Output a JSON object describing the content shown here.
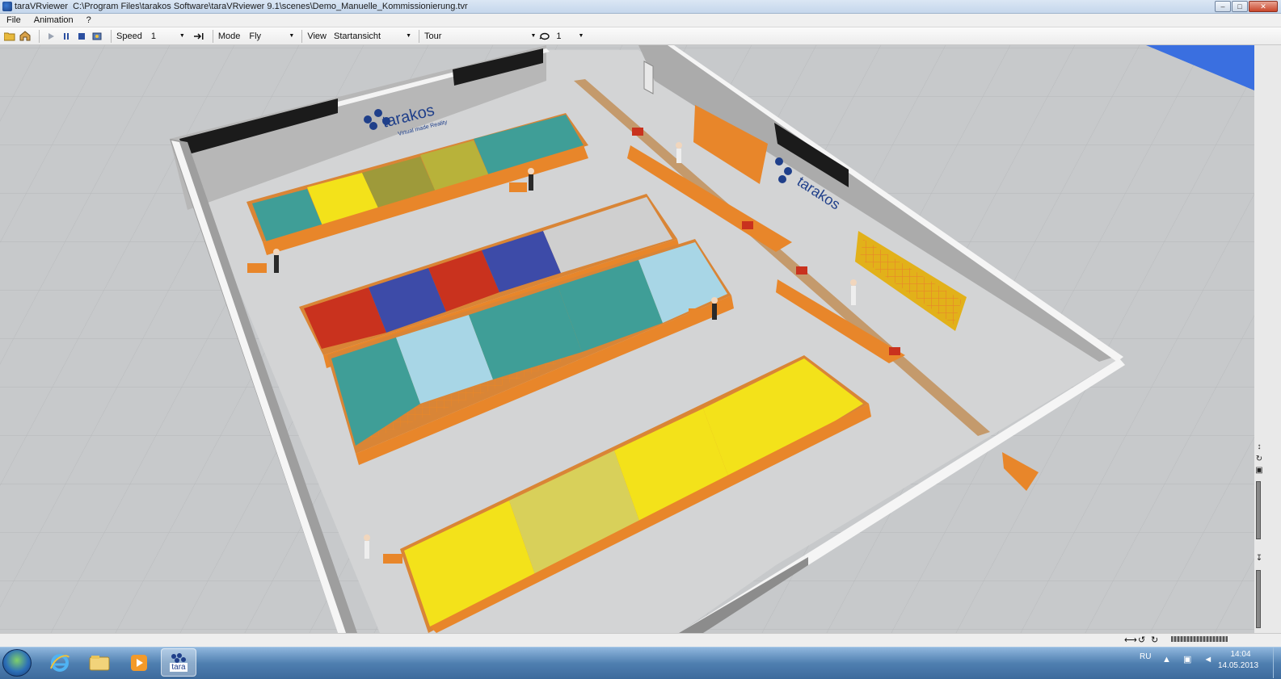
{
  "window": {
    "app_name": "taraVRviewer",
    "file_path": "C:\\Program Files\\tarakos Software\\taraVRviewer 9.1\\scenes\\Demo_Manuelle_Kommissionierung.tvr",
    "controls": {
      "minimize": "–",
      "maximize": "□",
      "close": "✕"
    }
  },
  "menu": [
    {
      "label": "File"
    },
    {
      "label": "Animation"
    },
    {
      "label": "?"
    }
  ],
  "toolbar": {
    "speed_label": "Speed",
    "speed_value": "1",
    "mode_label": "Mode",
    "mode_value": "Fly",
    "view_label": "View",
    "view_value": "Startansicht",
    "tour_label": "Tour",
    "tour_value": "",
    "loop_value": "1",
    "icons": [
      "open-folder-icon",
      "home-icon",
      "play-icon",
      "pause-icon",
      "stop-icon",
      "record-icon",
      "jump-end-icon",
      "loop-icon"
    ]
  },
  "scene": {
    "logo_text": "tarakos",
    "logo_tagline": "Virtual made Reality",
    "colors": {
      "floor": "#c8cacc",
      "inner_floor": "#d6d7d8",
      "wall": "#b0b0b0",
      "rack_frame": "#e8862a",
      "teal_bin": "#3f9e97",
      "light_blue_bin": "#a8d6e6",
      "yellow_bin": "#f3e21a",
      "olive_bin": "#9e9a3a",
      "red_bin": "#c9321e",
      "blue_bin": "#3d4ba8",
      "window_frame": "#1b1b1b",
      "logo_blue": "#1f3f8a"
    }
  },
  "statusbar": {
    "icons": [
      "navigate-icon",
      "rotate-left-icon",
      "rotate-right-icon",
      "zoom-slider"
    ]
  },
  "taskbar": {
    "apps": [
      "start-orb",
      "ie-icon",
      "explorer-icon",
      "media-player-icon",
      "tara-app-icon"
    ],
    "tara_label": "tara",
    "language": "RU",
    "time": "14:04",
    "date": "14.05.2013"
  }
}
